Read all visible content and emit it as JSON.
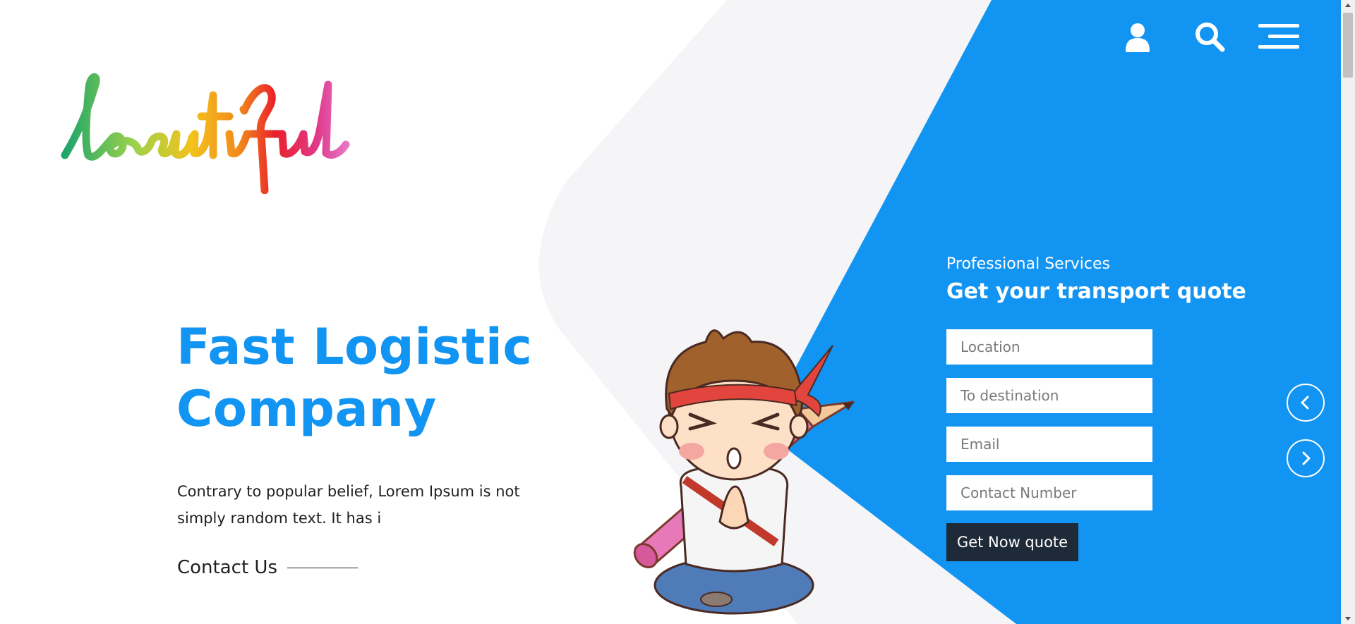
{
  "logo": {
    "text": "beautiful"
  },
  "header": {
    "icons": [
      "user-icon",
      "search-icon",
      "hamburger-menu-icon"
    ]
  },
  "hero": {
    "title": "Fast Logistic Company",
    "description": "Contrary to popular belief, Lorem Ipsum is not simply random text. It has i",
    "contact_label": "Contact Us"
  },
  "quote": {
    "subtitle": "Professional Services",
    "title": "Get your transport quote",
    "location_placeholder": "Location",
    "destination_placeholder": "To destination",
    "email_placeholder": "Email",
    "contact_placeholder": "Contact Number",
    "button_label": "Get Now quote"
  },
  "carousel": {
    "prev_icon": "chevron-left-icon",
    "next_icon": "chevron-right-icon"
  },
  "colors": {
    "accent": "#1294f2",
    "panel_blue": "#1294f2",
    "light_gray": "#f5f5f7",
    "dark_button": "#1e2a38",
    "text": "#1f1f1f"
  }
}
